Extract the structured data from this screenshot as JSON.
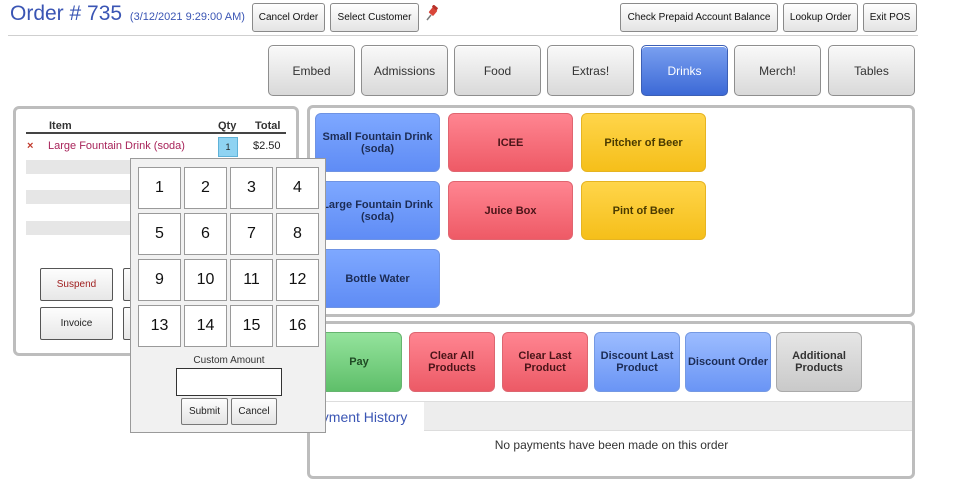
{
  "header": {
    "order_title": "Order # 735",
    "order_timestamp": "(3/12/2021 9:29:00 AM)",
    "buttons": {
      "cancel_order": "Cancel Order",
      "select_customer": "Select Customer",
      "check_prepaid": "Check Prepaid Account Balance",
      "lookup_order": "Lookup Order",
      "exit_pos": "Exit POS"
    },
    "pin_icon": "pushpin-icon"
  },
  "categories": [
    "Embed",
    "Admissions",
    "Food",
    "Extras!",
    "Drinks",
    "Merch!",
    "Tables"
  ],
  "active_category": "Drinks",
  "order": {
    "columns": {
      "item": "Item",
      "qty": "Qty",
      "total": "Total"
    },
    "items": [
      {
        "remove": "×",
        "name": "Large Fountain Drink (soda)",
        "qty": "1",
        "total": "$2.50"
      }
    ],
    "actions": {
      "suspend": "Suspend",
      "invoice": "Invoice"
    }
  },
  "keypad": {
    "keys": [
      "1",
      "2",
      "3",
      "4",
      "5",
      "6",
      "7",
      "8",
      "9",
      "10",
      "11",
      "12",
      "13",
      "14",
      "15",
      "16"
    ],
    "custom_amount_label": "Custom Amount",
    "custom_amount_value": "",
    "submit": "Submit",
    "cancel": "Cancel"
  },
  "products": [
    {
      "label": "Small Fountain Drink (soda)",
      "color": "#6f9cff"
    },
    {
      "label": "ICEE",
      "color": "#f56a76"
    },
    {
      "label": "Pitcher of Beer",
      "color": "#f8c82c"
    },
    {
      "label": "Large Fountain Drink (soda)",
      "color": "#6f9cff"
    },
    {
      "label": "Juice Box",
      "color": "#f56a76"
    },
    {
      "label": "Pint of Beer",
      "color": "#f8c82c"
    },
    {
      "label": "Bottle Water",
      "color": "#6f9cff"
    }
  ],
  "actions": [
    {
      "label": "Pay",
      "color": "#6fcc79"
    },
    {
      "label": "Clear All Products",
      "color": "#f56a76"
    },
    {
      "label": "Clear Last Product",
      "color": "#f56a76"
    },
    {
      "label": "Discount Last Product",
      "color": "#7ea4fb"
    },
    {
      "label": "Discount Order",
      "color": "#7ea4fb"
    },
    {
      "label": "Additional Products",
      "color": "#d6d6d6"
    }
  ],
  "payment_history": {
    "tab": "ayment History",
    "empty_message": "No payments have been made on this order"
  }
}
